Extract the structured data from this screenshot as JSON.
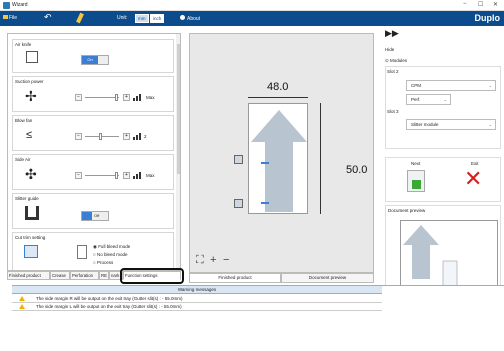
{
  "window": {
    "title": "Wizard",
    "minimize": "−",
    "maximize": "☐",
    "close": "✕"
  },
  "toolbar": {
    "file": "File",
    "unit_label": "Unit:",
    "unit_mm": "mm",
    "unit_inch": "inch",
    "about": "About",
    "brand": "Duplo"
  },
  "settings": {
    "air_knife": {
      "label": "Air knife",
      "value": "On"
    },
    "suction_power": {
      "label": "Suction power",
      "max": "Max"
    },
    "blow_fan": {
      "label": "Blow fan",
      "value": "2"
    },
    "side_air": {
      "label": "Side Air",
      "max": "Max"
    },
    "slitter_guide": {
      "label": "Slitter guide",
      "value": "Off"
    },
    "cut_trim": {
      "label": "Cut trim setting",
      "opt1": "Full bleed mode",
      "opt2": "No bleed mode",
      "opt3": "Process"
    }
  },
  "left_tabs": [
    "Finished product",
    "Crease",
    "Perforation",
    "RE",
    "nark",
    "Function settings"
  ],
  "preview": {
    "width": "48.0",
    "height": "50.0"
  },
  "center_tabs": [
    "Finished product",
    "Document preview"
  ],
  "right": {
    "hide": "Hide",
    "modules": "Modules",
    "slot2": "Slot 2",
    "slot2_module": "CPM",
    "slot2_sub": "Perf.",
    "slot3": "Slot 3",
    "slot3_module": "Slitter module",
    "next": "Next",
    "exit": "Exit",
    "doc_preview": "Document preview"
  },
  "warnings": {
    "header": "Warning messages",
    "rows": [
      "The side margin R will be output on the exit tray (Gutter slit(s) : - 55.0mm)",
      "The side margin L will be output on the exit tray (Gutter slit(s) : - 55.0mm)"
    ]
  },
  "colors": {
    "toolbar": "#0d4c8c",
    "accent": "#3b7fd4",
    "arrow": "#b8c4cf",
    "exit_x": "#d42020",
    "next_icon": "#3aaa35"
  }
}
